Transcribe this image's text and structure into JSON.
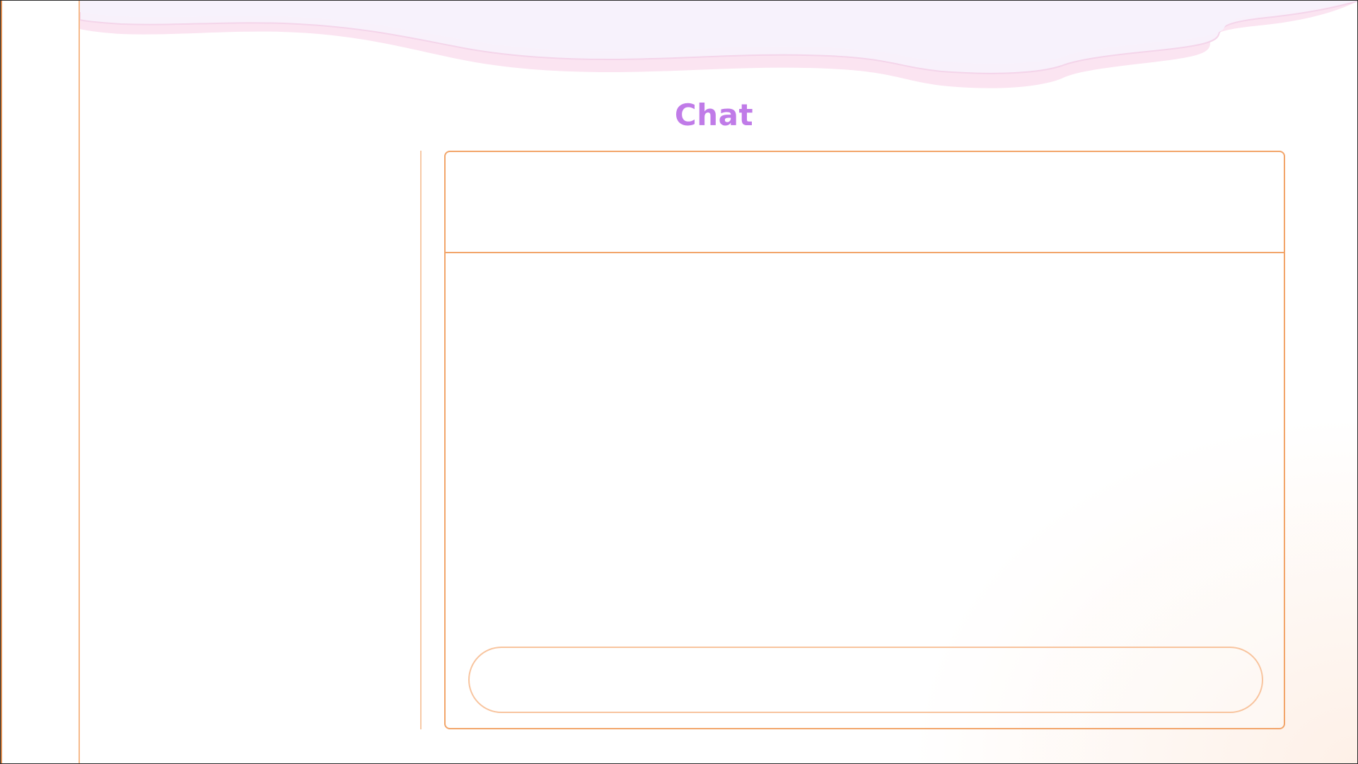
{
  "page": {
    "title": "Chat"
  },
  "chat": {
    "input_value": "",
    "input_placeholder": ""
  },
  "colors": {
    "accent_title": "#c07be8",
    "panel_border": "#f2a56a",
    "input_border": "#f8c49e",
    "divider": "#f7c9a6",
    "wave_fill": "#f8f1fb",
    "wave_edge": "#f6d9ec"
  }
}
